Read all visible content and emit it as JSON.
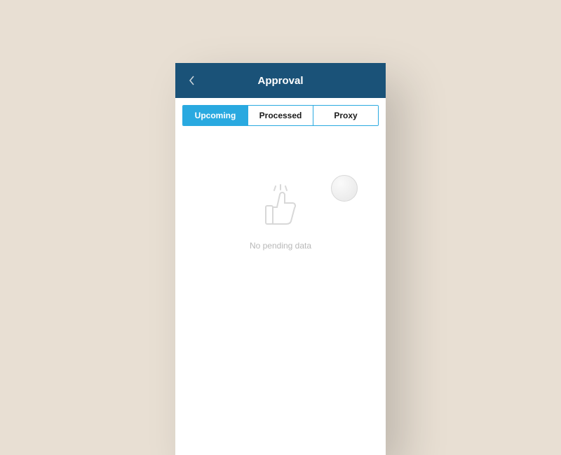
{
  "header": {
    "title": "Approval"
  },
  "tabs": [
    {
      "label": "Upcoming",
      "active": true
    },
    {
      "label": "Processed",
      "active": false
    },
    {
      "label": "Proxy",
      "active": false
    }
  ],
  "empty_state": {
    "message": "No pending data"
  },
  "colors": {
    "header_bg": "#1a5278",
    "tab_active": "#29a9e0",
    "background": "#e8dfd3"
  }
}
